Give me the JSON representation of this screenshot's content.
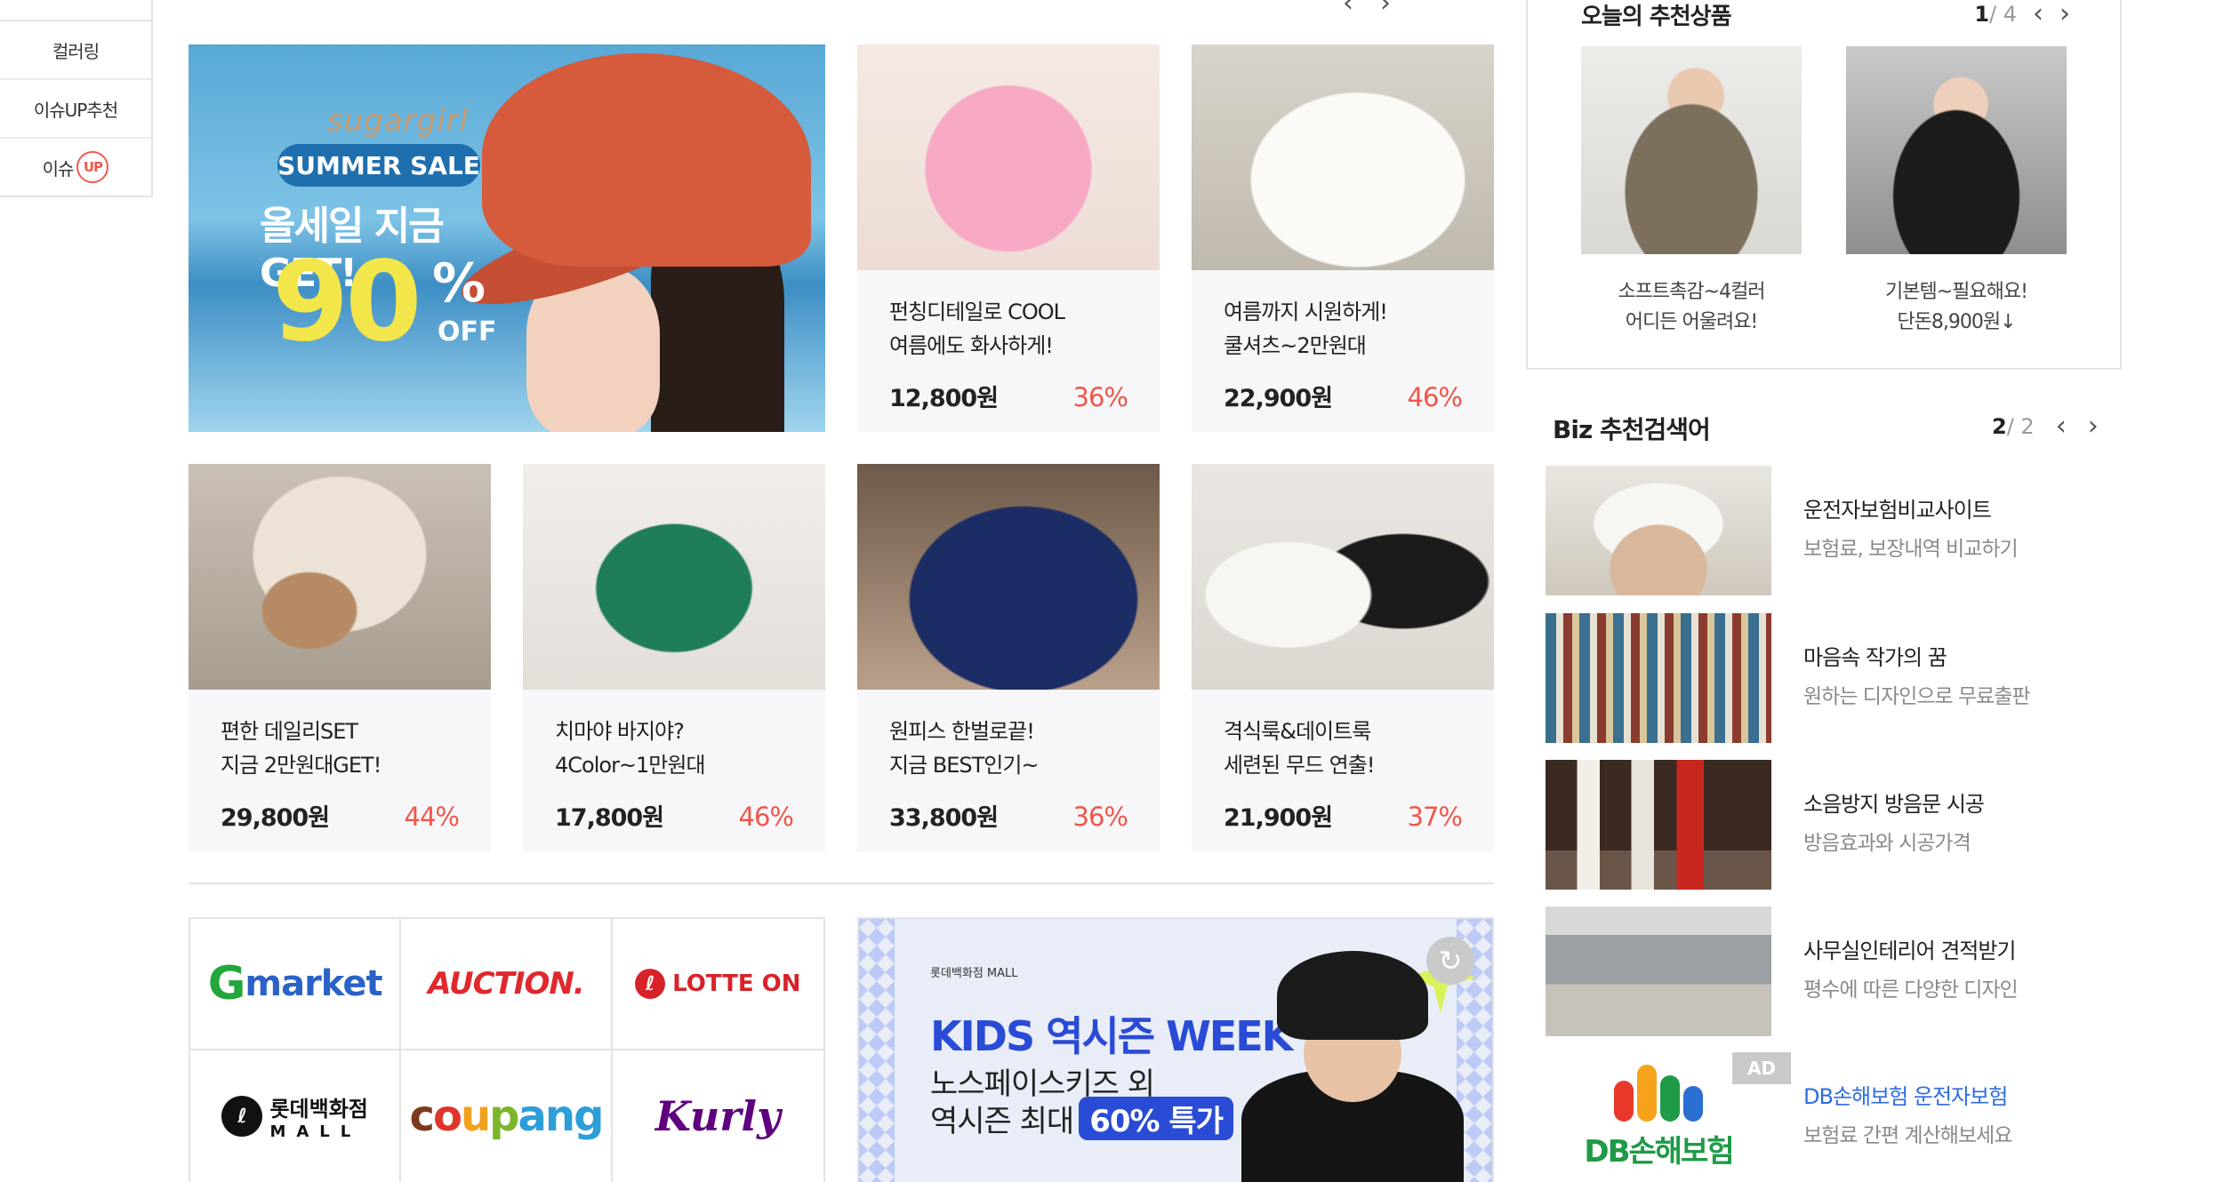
{
  "sidebar": {
    "items": [
      {
        "label": "컬러링"
      },
      {
        "label": "이슈UP추천"
      },
      {
        "label": "이슈",
        "badge": "UP"
      }
    ]
  },
  "top_pager": {
    "prev": "‹",
    "next": "›"
  },
  "hero_banner": {
    "brand": "sugargirl",
    "pill": "SUMMER SALE",
    "headline": "올세일 지금 GET!",
    "big": "90",
    "pct": "%",
    "off": "OFF"
  },
  "products": [
    {
      "line1": "펀칭디테일로 COOL",
      "line2": "여름에도 화사하게!",
      "price": "12,800원",
      "rate": "36%"
    },
    {
      "line1": "여름까지 시원하게!",
      "line2": "쿨셔츠~2만원대",
      "price": "22,900원",
      "rate": "46%"
    },
    {
      "line1": "편한 데일리SET",
      "line2": "지금 2만원대GET!",
      "price": "29,800원",
      "rate": "44%"
    },
    {
      "line1": "치마야 바지야?",
      "line2": "4Color~1만원대",
      "price": "17,800원",
      "rate": "46%"
    },
    {
      "line1": "원피스 한벌로끝!",
      "line2": "지금 BEST인기~",
      "price": "33,800원",
      "rate": "36%"
    },
    {
      "line1": "격식룩&데이트룩",
      "line2": "세련된 무드 연출!",
      "price": "21,900원",
      "rate": "37%"
    }
  ],
  "malls": {
    "gmarket_g": "G",
    "gmarket_rest": "market",
    "auction": "AUCTION.",
    "lotteon_dot": "ℓ",
    "lotteon": "LOTTE ON",
    "lotte_dot": "ℓ",
    "lotte": "롯데백화점",
    "lotte_sub": "MALL",
    "coupang": "coupang",
    "kurly": "Kurly"
  },
  "kids_banner": {
    "brand": "롯데백화점 MALL",
    "title": "KIDS 역시즌 WEEK",
    "line1": "노스페이스키즈 외",
    "line2": "역시즌 최대",
    "badge": "60% 특가",
    "refresh": "↻"
  },
  "today": {
    "title": "오늘의 추천상품",
    "page_current": "1",
    "page_total": "/ 4",
    "prev": "‹",
    "next": "›",
    "items": [
      {
        "line1": "소프트촉감~4컬러",
        "line2": "어디든 어울려요!"
      },
      {
        "line1": "기본템~필요해요!",
        "line2": "단돈8,900원↓"
      }
    ]
  },
  "biz": {
    "title": "Biz 추천검색어",
    "page_current": "2",
    "page_total": "/ 2",
    "prev": "‹",
    "next": "›",
    "items": [
      {
        "title": "운전자보험비교사이트",
        "sub": "보험료, 보장내역 비교하기"
      },
      {
        "title": "마음속 작가의 꿈",
        "sub": "원하는 디자인으로 무료출판"
      },
      {
        "title": "소음방지 방음문 시공",
        "sub": "방음효과와 시공가격"
      },
      {
        "title": "사무실인테리어 견적받기",
        "sub": "평수에 따른 다양한 디자인"
      },
      {
        "title": "DB손해보험 운전자보험",
        "sub": "보험료 간편 계산해보세요",
        "ad": "AD",
        "logo_text": "DB손해보험"
      }
    ]
  },
  "colors": {
    "discount": "#f0564a",
    "ad_link": "#2d6be0",
    "kids_blue": "#2a4bd6"
  }
}
